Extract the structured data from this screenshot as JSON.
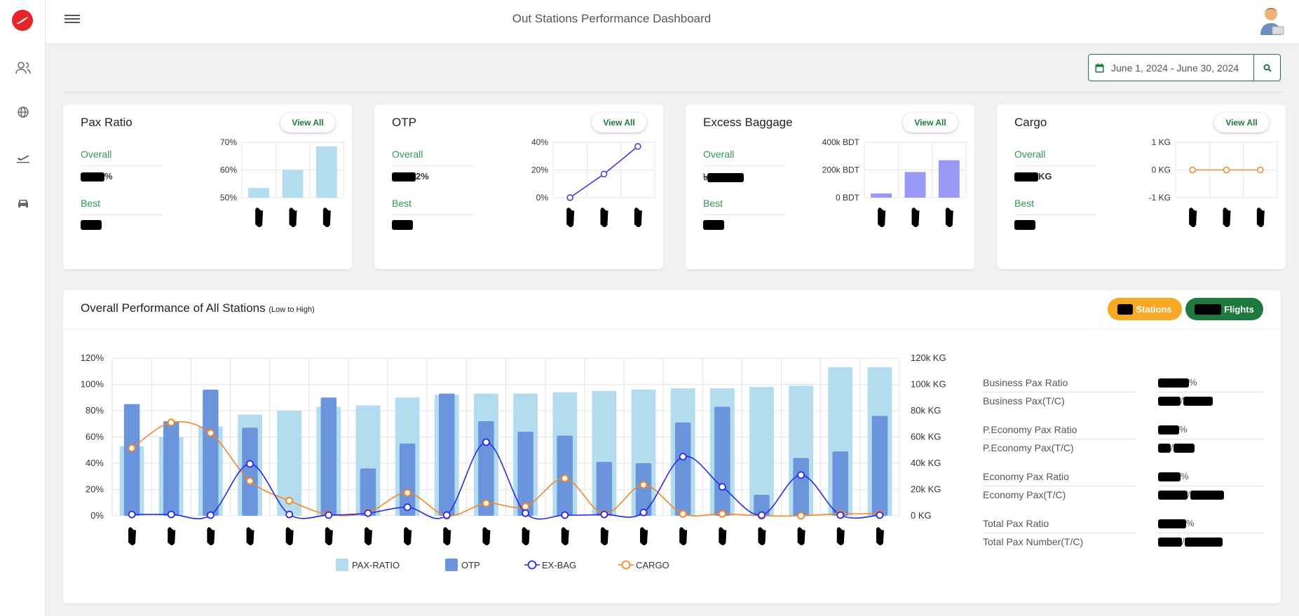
{
  "app": {
    "title": "Out Stations Performance Dashboard"
  },
  "sidebar": {
    "items": [
      {
        "icon": "users-icon"
      },
      {
        "icon": "globe-icon"
      },
      {
        "icon": "plane-icon"
      },
      {
        "icon": "car-icon"
      }
    ]
  },
  "date_filter": {
    "value": "June 1, 2024 - June 30, 2024"
  },
  "cards": [
    {
      "title": "Pax Ratio",
      "view_all": "View All",
      "overall_label": "Overall",
      "overall_suffix": "%",
      "best_label": "Best",
      "chart_data": {
        "type": "bar",
        "categories": [
          "",
          "",
          ""
        ],
        "values": [
          53.5,
          60,
          68.5
        ],
        "yticks": [
          "70%",
          "60%",
          "50%"
        ],
        "ylim": [
          50,
          70
        ],
        "color": "#b3dcee"
      }
    },
    {
      "title": "OTP",
      "view_all": "View All",
      "overall_label": "Overall",
      "overall_suffix": "2%",
      "best_label": "Best",
      "chart_data": {
        "type": "line",
        "categories": [
          "",
          "",
          ""
        ],
        "values": [
          0,
          17,
          37
        ],
        "yticks": [
          "40%",
          "20%",
          "0%"
        ],
        "ylim": [
          0,
          40
        ],
        "color": "#3a3ae0"
      }
    },
    {
      "title": "Excess Baggage",
      "view_all": "View All",
      "overall_label": "Overall",
      "overall_prefix": "৳",
      "best_label": "Best",
      "chart_data": {
        "type": "bar",
        "categories": [
          "",
          "",
          ""
        ],
        "values": [
          30000,
          185000,
          270000
        ],
        "yticks": [
          "400k BDT",
          "200k BDT",
          "0 BDT"
        ],
        "ylim": [
          0,
          400000
        ],
        "color": "#9a98f5"
      }
    },
    {
      "title": "Cargo",
      "view_all": "View All",
      "overall_label": "Overall",
      "overall_suffix": "KG",
      "best_label": "Best",
      "chart_data": {
        "type": "line",
        "categories": [
          "",
          "",
          ""
        ],
        "values": [
          0,
          0,
          0
        ],
        "yticks": [
          "1 KG",
          "0 KG",
          "-1 KG"
        ],
        "ylim": [
          -1,
          1
        ],
        "color": "#f5862a"
      }
    }
  ],
  "overall": {
    "title": "Overall Performance of All Stations",
    "subtitle": "(Low to High)",
    "stations_label": "Stations",
    "flights_label": "Flights",
    "chart_data": {
      "type": "bar",
      "categories": [
        "",
        "",
        "",
        "",
        "",
        "",
        "",
        "",
        "",
        "",
        "",
        "",
        "",
        "",
        "",
        "",
        "",
        "",
        "",
        ""
      ],
      "y_left_ticks": [
        "120%",
        "100%",
        "80%",
        "60%",
        "40%",
        "20%",
        "0%"
      ],
      "y_right_ticks": [
        "120k KG",
        "100k KG",
        "80k KG",
        "60k KG",
        "40k KG",
        "20k KG",
        "0 KG"
      ],
      "ylim_left": [
        0,
        120
      ],
      "ylim_right": [
        0,
        120000
      ],
      "series": [
        {
          "name": "PAX-RATIO",
          "type": "bar",
          "color": "#b3dcee",
          "values": [
            53,
            60,
            68,
            77,
            80,
            83,
            84,
            90,
            92,
            93,
            93,
            94,
            95,
            96,
            97,
            97,
            98,
            99,
            113,
            113
          ]
        },
        {
          "name": "OTP",
          "type": "bar",
          "color": "#6a94dc",
          "values": [
            85,
            72,
            96,
            67,
            0,
            90,
            36,
            55,
            93,
            72,
            64,
            61,
            41,
            40,
            71,
            83,
            16,
            44,
            49,
            76
          ]
        },
        {
          "name": "EX-BAG",
          "type": "line",
          "color": "#2a2ae6",
          "values": [
            1,
            1,
            0.5,
            39.5,
            1,
            0.5,
            2,
            6.5,
            0.5,
            56,
            2,
            0.5,
            1,
            2.5,
            45,
            22,
            0.5,
            31,
            0.5,
            0.5
          ]
        },
        {
          "name": "CARGO",
          "type": "line",
          "color": "#f5862a",
          "values": [
            51500,
            71000,
            63000,
            26500,
            11500,
            1000,
            2500,
            17500,
            0.5,
            9500,
            7000,
            28500,
            1500,
            23500,
            1500,
            1500,
            0.5,
            0.5,
            1500,
            1500
          ]
        }
      ]
    },
    "ratios": [
      {
        "label": "Business Pax Ratio",
        "value": "%"
      },
      {
        "label": "Business Pax(T/C)",
        "value": "/"
      },
      {
        "label": "P.Economy Pax Ratio",
        "value": "%"
      },
      {
        "label": "P.Economy Pax(T/C)",
        "value": "/"
      },
      {
        "label": "Economy Pax Ratio",
        "value": "%"
      },
      {
        "label": "Economy Pax(T/C)",
        "value": "/"
      },
      {
        "label": "Total Pax Ratio",
        "value": "%"
      },
      {
        "label": "Total Pax Number(T/C)",
        "value": "/"
      }
    ]
  }
}
